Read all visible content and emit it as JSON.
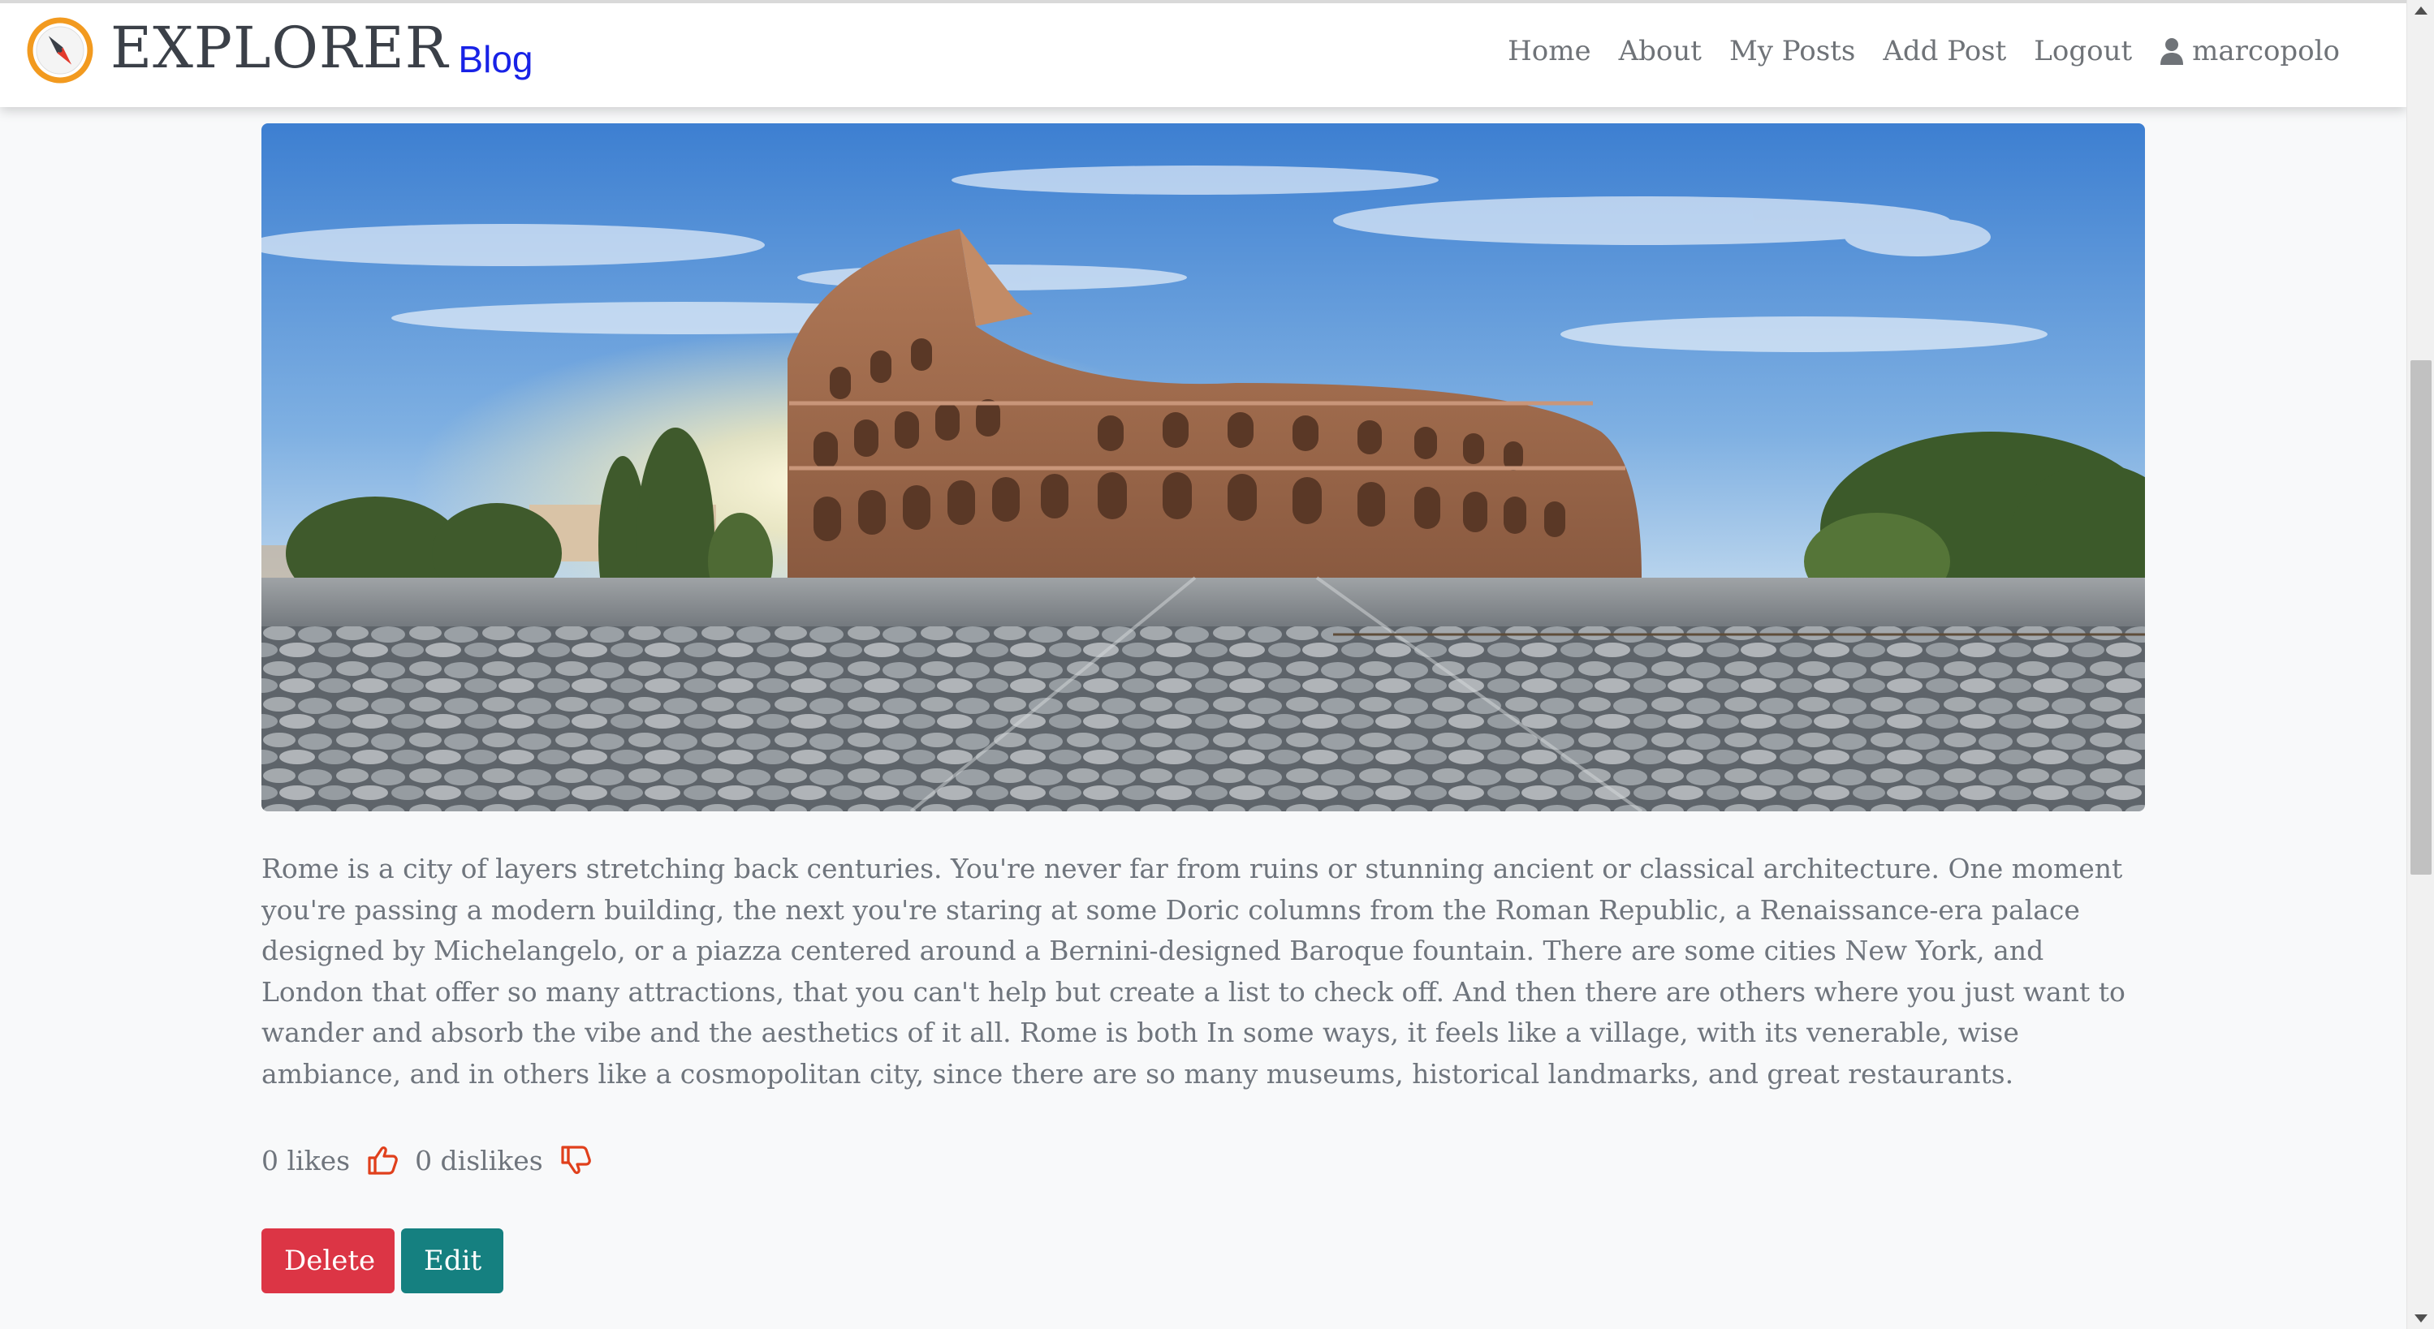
{
  "brand": {
    "name": "EXPLORER",
    "sub": "Blog",
    "logo_icon": "compass-icon"
  },
  "nav": {
    "links": [
      "Home",
      "About",
      "My Posts",
      "Add Post",
      "Logout"
    ],
    "username": "marcopolo",
    "user_icon": "user-icon"
  },
  "post": {
    "image_alt": "Colosseum in Rome at sunrise",
    "body": "Rome is a city of layers stretching back centuries. You're never far from ruins or stunning ancient or classical architecture. One moment you're passing a modern building, the next you're staring at some Doric columns from the Roman Republic, a Renaissance-era palace designed by Michelangelo, or a piazza centered around a Bernini-designed Baroque fountain. There are some cities New York, and London that offer so many attractions, that you can't help but create a list to check off. And then there are others where you just want to wander and absorb the vibe and the aesthetics of it all. Rome is both In some ways, it feels like a village, with its venerable, wise ambiance, and in others like a cosmopolitan city, since there are so many museums, historical landmarks, and great restaurants."
  },
  "reactions": {
    "likes_label": "0 likes",
    "dislikes_label": "0 dislikes",
    "like_icon": "thumbs-up-icon",
    "dislike_icon": "thumbs-down-icon",
    "icon_color": "#e0401c"
  },
  "actions": {
    "delete_label": "Delete",
    "edit_label": "Edit",
    "delete_color": "#dc3545",
    "edit_color": "#158080"
  },
  "colors": {
    "brand_text": "#3b4048",
    "brand_sub": "#1822e6",
    "logo_ring": "#f29a1f",
    "page_bg": "#f8f9fa"
  }
}
